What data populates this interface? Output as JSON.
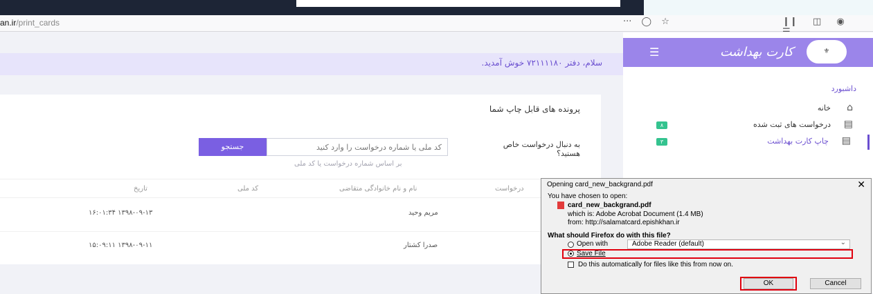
{
  "browser": {
    "url_domain": "an.ir",
    "url_path": "/print_cards",
    "toolbar_icons": [
      "more-icon",
      "pocket-icon",
      "star-icon",
      "library-icon",
      "sidebar-icon",
      "extension-icon",
      "menu-icon"
    ]
  },
  "header": {
    "greeting": "سلام، دفتر ۷۲۱۱۱۱۸۰ خوش آمدید."
  },
  "sidebar": {
    "brand": "کارت بهداشت",
    "section_title": "داشبورد",
    "items": [
      {
        "label": "خانه",
        "icon": "home-icon",
        "badge": ""
      },
      {
        "label": "درخواست های ثبت شده",
        "icon": "document-icon",
        "badge": "۸"
      },
      {
        "label": "چاپ کارت بهداشت",
        "icon": "document-icon",
        "badge": "۳"
      }
    ]
  },
  "main": {
    "card_title": "پرونده های قابل چاپ شما",
    "search_question": "به دنبال درخواست خاص هستید؟",
    "search_placeholder": "کد ملی یا شماره درخواست را وارد کنید",
    "search_button": "جستجو",
    "search_hint": "بر اساس شماره درخواست یا کد ملی",
    "table": {
      "columns": [
        "درخواست",
        "نام و نام خانوادگی متقاضی",
        "کد ملی",
        "تاریخ"
      ],
      "rows": [
        {
          "name": "مریم وحید",
          "date": "۱۳۹۸-۰۹-۱۳ ۱۶:۰۱:۳۴"
        },
        {
          "name": "صدرا کشتار",
          "date": "۱۳۹۸-۰۹-۱۱ ۱۵:۰۹:۱۱"
        }
      ]
    }
  },
  "dialog": {
    "title": "Opening card_new_backgrand.pdf",
    "chosen_text": "You have chosen to open:",
    "filename": "card_new_backgrand.pdf",
    "which_is": "which is: Adobe Acrobat Document (1.4 MB)",
    "from": "from: http://salamatcard.epishkhan.ir",
    "question": "What should Firefox do with this file?",
    "open_with_label": "Open with",
    "open_with_app": "Adobe Reader  (default)",
    "save_file_label": "Save File",
    "auto_label": "Do this automatically for files like this from now on.",
    "ok_label": "OK",
    "cancel_label": "Cancel",
    "selected_option": "save_file",
    "highlight_color": "#e0000e"
  },
  "colors": {
    "accent": "#7a5fe2",
    "sidebar_header": "#9b85ea",
    "badge": "#34c38f"
  }
}
